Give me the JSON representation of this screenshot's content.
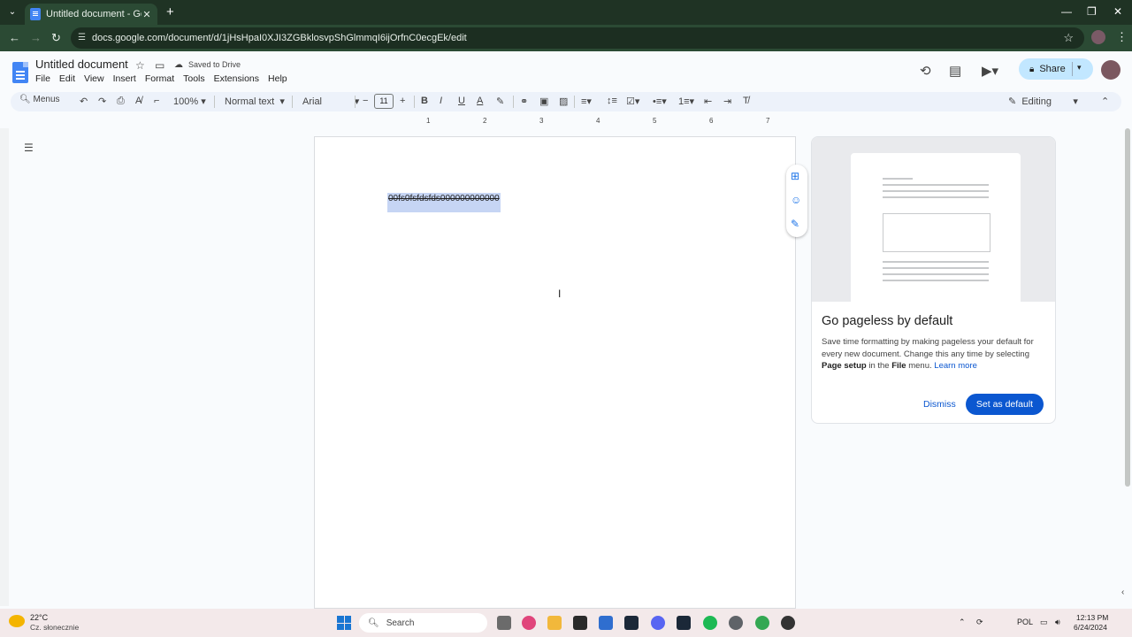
{
  "browser": {
    "tab_title": "Untitled document - Google Do",
    "url": "docs.google.com/document/d/1jHsHpaI0XJI3ZGBklosvpShGlmmqI6ijOrfnC0ecgEk/edit"
  },
  "docs": {
    "title": "Untitled document",
    "saved_status": "Saved to Drive",
    "menu": [
      "File",
      "Edit",
      "View",
      "Insert",
      "Format",
      "Tools",
      "Extensions",
      "Help"
    ],
    "share_label": "Share"
  },
  "toolbar": {
    "search_label": "Menus",
    "zoom": "100%",
    "style": "Normal text",
    "font": "Arial",
    "font_size": "11",
    "mode": "Editing"
  },
  "ruler": [
    "1",
    "1",
    "2",
    "3",
    "4",
    "5",
    "6",
    "7"
  ],
  "document": {
    "selected_text": "00fs0fsfdsfds000000000000"
  },
  "promo": {
    "title": "Go pageless by default",
    "body_1": "Save time formatting by making pageless your default for every new document. Change this any time by selecting ",
    "body_bold_1": "Page setup",
    "body_2": " in the ",
    "body_bold_2": "File",
    "body_3": " menu. ",
    "learn_more": "Learn more",
    "dismiss": "Dismiss",
    "set_default": "Set as default"
  },
  "taskbar": {
    "temp": "22°C",
    "weather": "Cz. słonecznie",
    "search": "Search",
    "lang": "POL",
    "time": "12:13 PM",
    "date": "6/24/2024"
  },
  "colors": {
    "browser_frame": "#1f3324",
    "share_bg": "#c2e7ff",
    "primary": "#0b57d0",
    "selection": "#c6d5f4"
  }
}
